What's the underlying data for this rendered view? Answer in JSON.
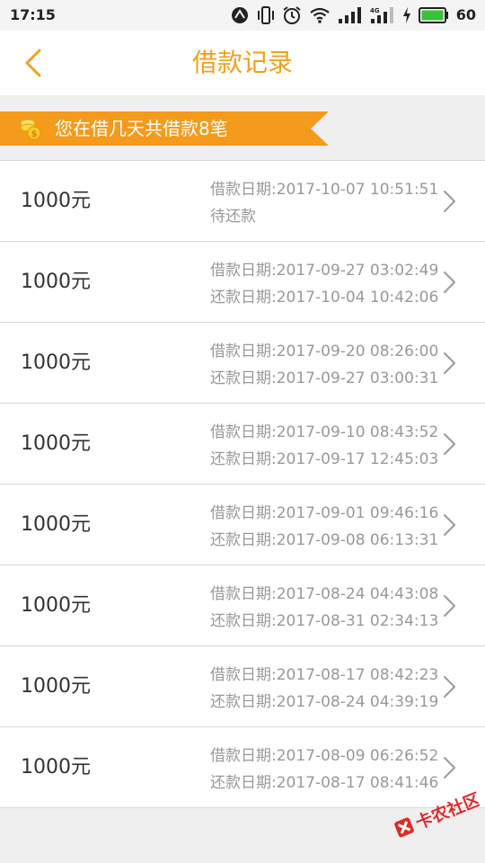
{
  "status_bar": {
    "time": "17:15",
    "battery": "60",
    "icons": [
      "signal-tracker-icon",
      "vibrate-icon",
      "alarm-icon",
      "wifi-icon",
      "cell-signal-icon",
      "cell-signal-4g-icon",
      "charging-icon",
      "battery-icon"
    ]
  },
  "nav": {
    "back_icon": "chevron-left-icon",
    "title": "借款记录"
  },
  "banner": {
    "icon": "coins-icon",
    "text": "您在借几天共借款8笔"
  },
  "records": [
    {
      "amount": "1000元",
      "line1": "借款日期:2017-10-07 10:51:51",
      "line2": "待还款"
    },
    {
      "amount": "1000元",
      "line1": "借款日期:2017-09-27 03:02:49",
      "line2": "还款日期:2017-10-04 10:42:06"
    },
    {
      "amount": "1000元",
      "line1": "借款日期:2017-09-20 08:26:00",
      "line2": "还款日期:2017-09-27 03:00:31"
    },
    {
      "amount": "1000元",
      "line1": "借款日期:2017-09-10 08:43:52",
      "line2": "还款日期:2017-09-17 12:45:03"
    },
    {
      "amount": "1000元",
      "line1": "借款日期:2017-09-01 09:46:16",
      "line2": "还款日期:2017-09-08 06:13:31"
    },
    {
      "amount": "1000元",
      "line1": "借款日期:2017-08-24 04:43:08",
      "line2": "还款日期:2017-08-31 02:34:13"
    },
    {
      "amount": "1000元",
      "line1": "借款日期:2017-08-17 08:42:23",
      "line2": "还款日期:2017-08-24 04:39:19"
    },
    {
      "amount": "1000元",
      "line1": "借款日期:2017-08-09 06:26:52",
      "line2": "还款日期:2017-08-17 08:41:46"
    }
  ],
  "watermark": {
    "text": "卡农社区"
  },
  "colors": {
    "accent": "#f0a01e",
    "banner": "#f49a1c",
    "battery": "#36c23a",
    "text_primary": "#333333",
    "text_secondary": "#999999"
  }
}
